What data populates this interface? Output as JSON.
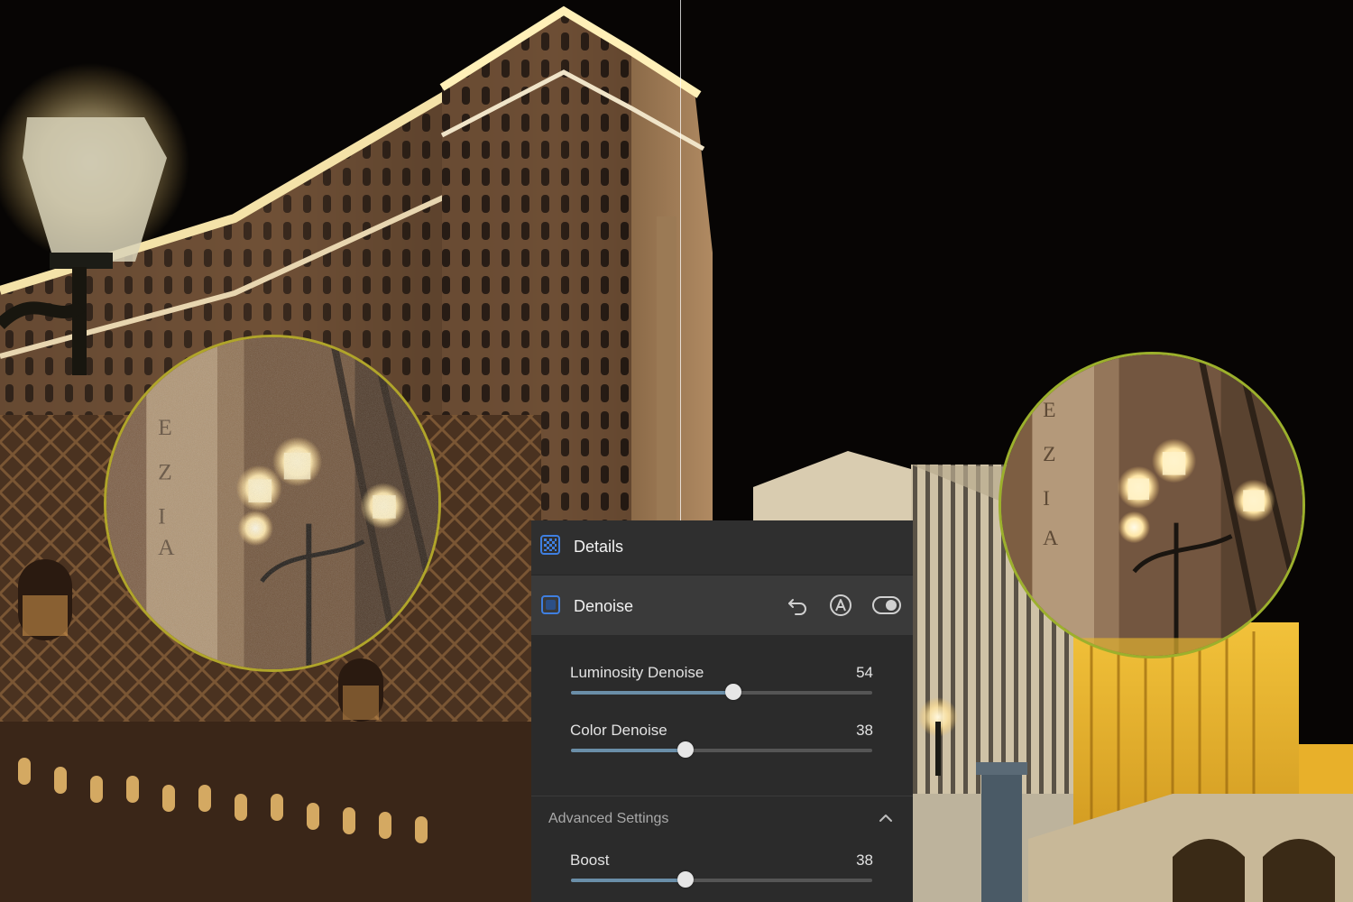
{
  "panel": {
    "title": "Details",
    "section": {
      "title": "Denoise",
      "sliders": [
        {
          "label": "Luminosity Denoise",
          "value": 54,
          "fraction": 0.54
        },
        {
          "label": "Color Denoise",
          "value": 38,
          "fraction": 0.38
        }
      ],
      "advanced": {
        "label": "Advanced Settings",
        "expanded": true,
        "sliders": [
          {
            "label": "Boost",
            "value": 38,
            "fraction": 0.38
          }
        ]
      }
    },
    "icons": {
      "details": "details-grid-icon",
      "section": "denoise-icon",
      "undo": "undo-icon",
      "auto": "auto-icon",
      "toggle": "visibility-toggle-icon",
      "collapse": "chevron-up-icon"
    },
    "colors": {
      "accent": "#3f7fe0",
      "slider_fill": "#6a8ea8",
      "panel_bg": "#2b2b2b"
    }
  }
}
